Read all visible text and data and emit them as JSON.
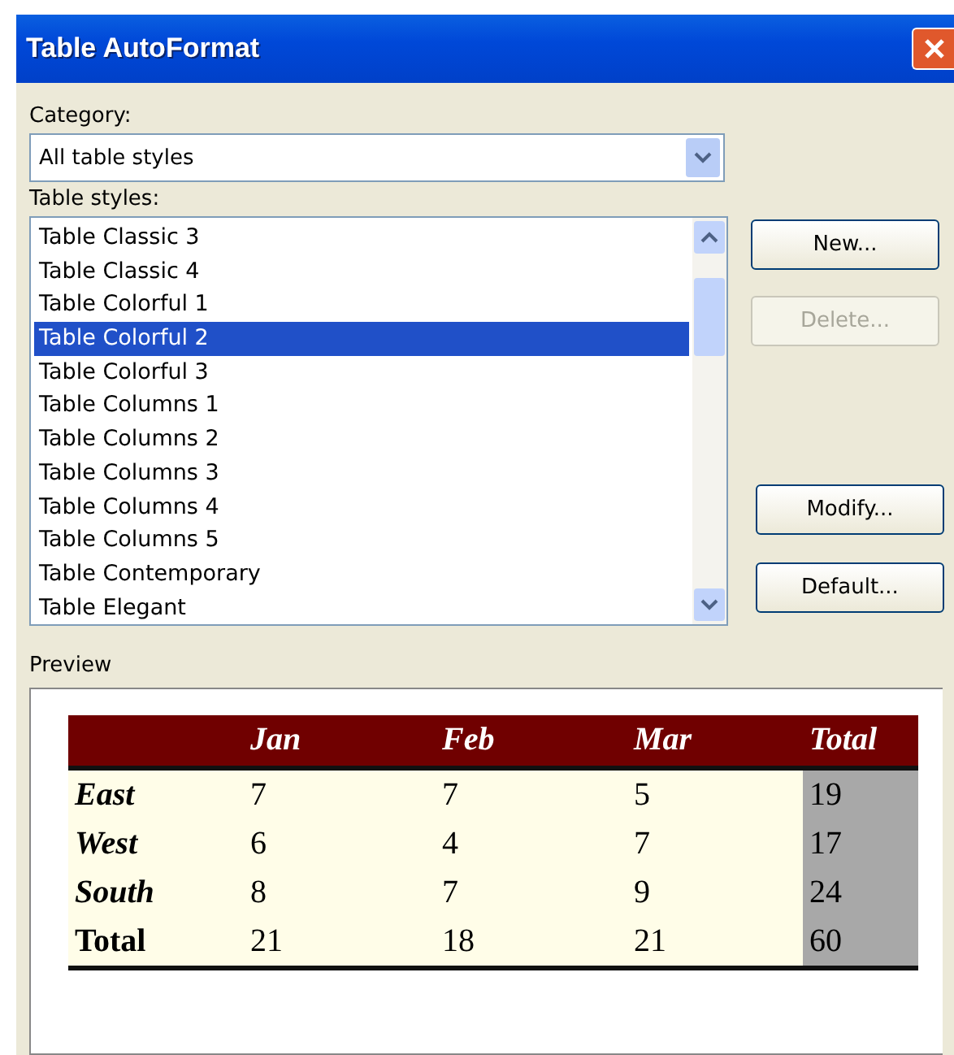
{
  "window": {
    "title": "Table AutoFormat"
  },
  "category": {
    "label": "Category:",
    "value": "All table styles"
  },
  "table_styles": {
    "label": "Table styles:",
    "items": [
      {
        "label": "Table Classic 3",
        "selected": false
      },
      {
        "label": "Table Classic 4",
        "selected": false
      },
      {
        "label": "Table Colorful 1",
        "selected": false
      },
      {
        "label": "Table Colorful 2",
        "selected": true
      },
      {
        "label": "Table Colorful 3",
        "selected": false
      },
      {
        "label": "Table Columns 1",
        "selected": false
      },
      {
        "label": "Table Columns 2",
        "selected": false
      },
      {
        "label": "Table Columns 3",
        "selected": false
      },
      {
        "label": "Table Columns 4",
        "selected": false
      },
      {
        "label": "Table Columns 5",
        "selected": false
      },
      {
        "label": "Table Contemporary",
        "selected": false
      },
      {
        "label": "Table Elegant",
        "selected": false
      }
    ]
  },
  "button_groups": [
    {
      "buttons": [
        {
          "label": "New...",
          "disabled": false
        },
        {
          "label": "Delete...",
          "disabled": true
        }
      ]
    },
    {
      "buttons": [
        {
          "label": "Modify...",
          "disabled": false
        },
        {
          "label": "Default...",
          "disabled": false
        }
      ]
    }
  ],
  "preview": {
    "label": "Preview",
    "columns": [
      "Jan",
      "Feb",
      "Mar",
      "Total"
    ],
    "rows": [
      {
        "kind": "data",
        "label": "East",
        "cells": [
          "7",
          "7",
          "5",
          "19"
        ]
      },
      {
        "kind": "data",
        "label": "West",
        "cells": [
          "6",
          "4",
          "7",
          "17"
        ]
      },
      {
        "kind": "data",
        "label": "South",
        "cells": [
          "8",
          "7",
          "9",
          "24"
        ]
      },
      {
        "kind": "total",
        "label": "Total",
        "cells": [
          "21",
          "18",
          "21",
          "60"
        ]
      }
    ]
  }
}
